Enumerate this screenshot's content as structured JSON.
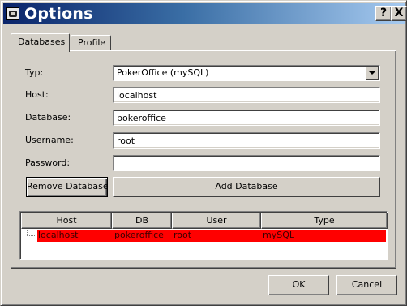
{
  "window": {
    "title": "Options",
    "help_label": "?",
    "close_label": "X"
  },
  "tabs": [
    {
      "label": "Databases",
      "active": true
    },
    {
      "label": "Profile",
      "active": false
    }
  ],
  "form": {
    "typ_label": "Typ:",
    "typ_value": "PokerOffice (mySQL)",
    "host_label": "Host:",
    "host_value": "localhost",
    "database_label": "Database:",
    "database_value": "pokeroffice",
    "username_label": "Username:",
    "username_value": "root",
    "password_label": "Password:",
    "password_value": ""
  },
  "buttons": {
    "remove_database": "Remove Database",
    "add_database": "Add Database",
    "ok": "OK",
    "cancel": "Cancel"
  },
  "list": {
    "columns": [
      "Host",
      "DB",
      "User",
      "Type"
    ],
    "rows": [
      {
        "host": "localhost",
        "db": "pokeroffice",
        "user": "root",
        "type": "mySQL",
        "selected": true
      }
    ]
  },
  "colors": {
    "selection": "#ff0000",
    "titlebar_start": "#0a246a",
    "titlebar_end": "#a6caf0",
    "face": "#d4d0c8"
  },
  "icons": {
    "app": "poker-app-icon",
    "dropdown": "chevron-down-icon"
  }
}
